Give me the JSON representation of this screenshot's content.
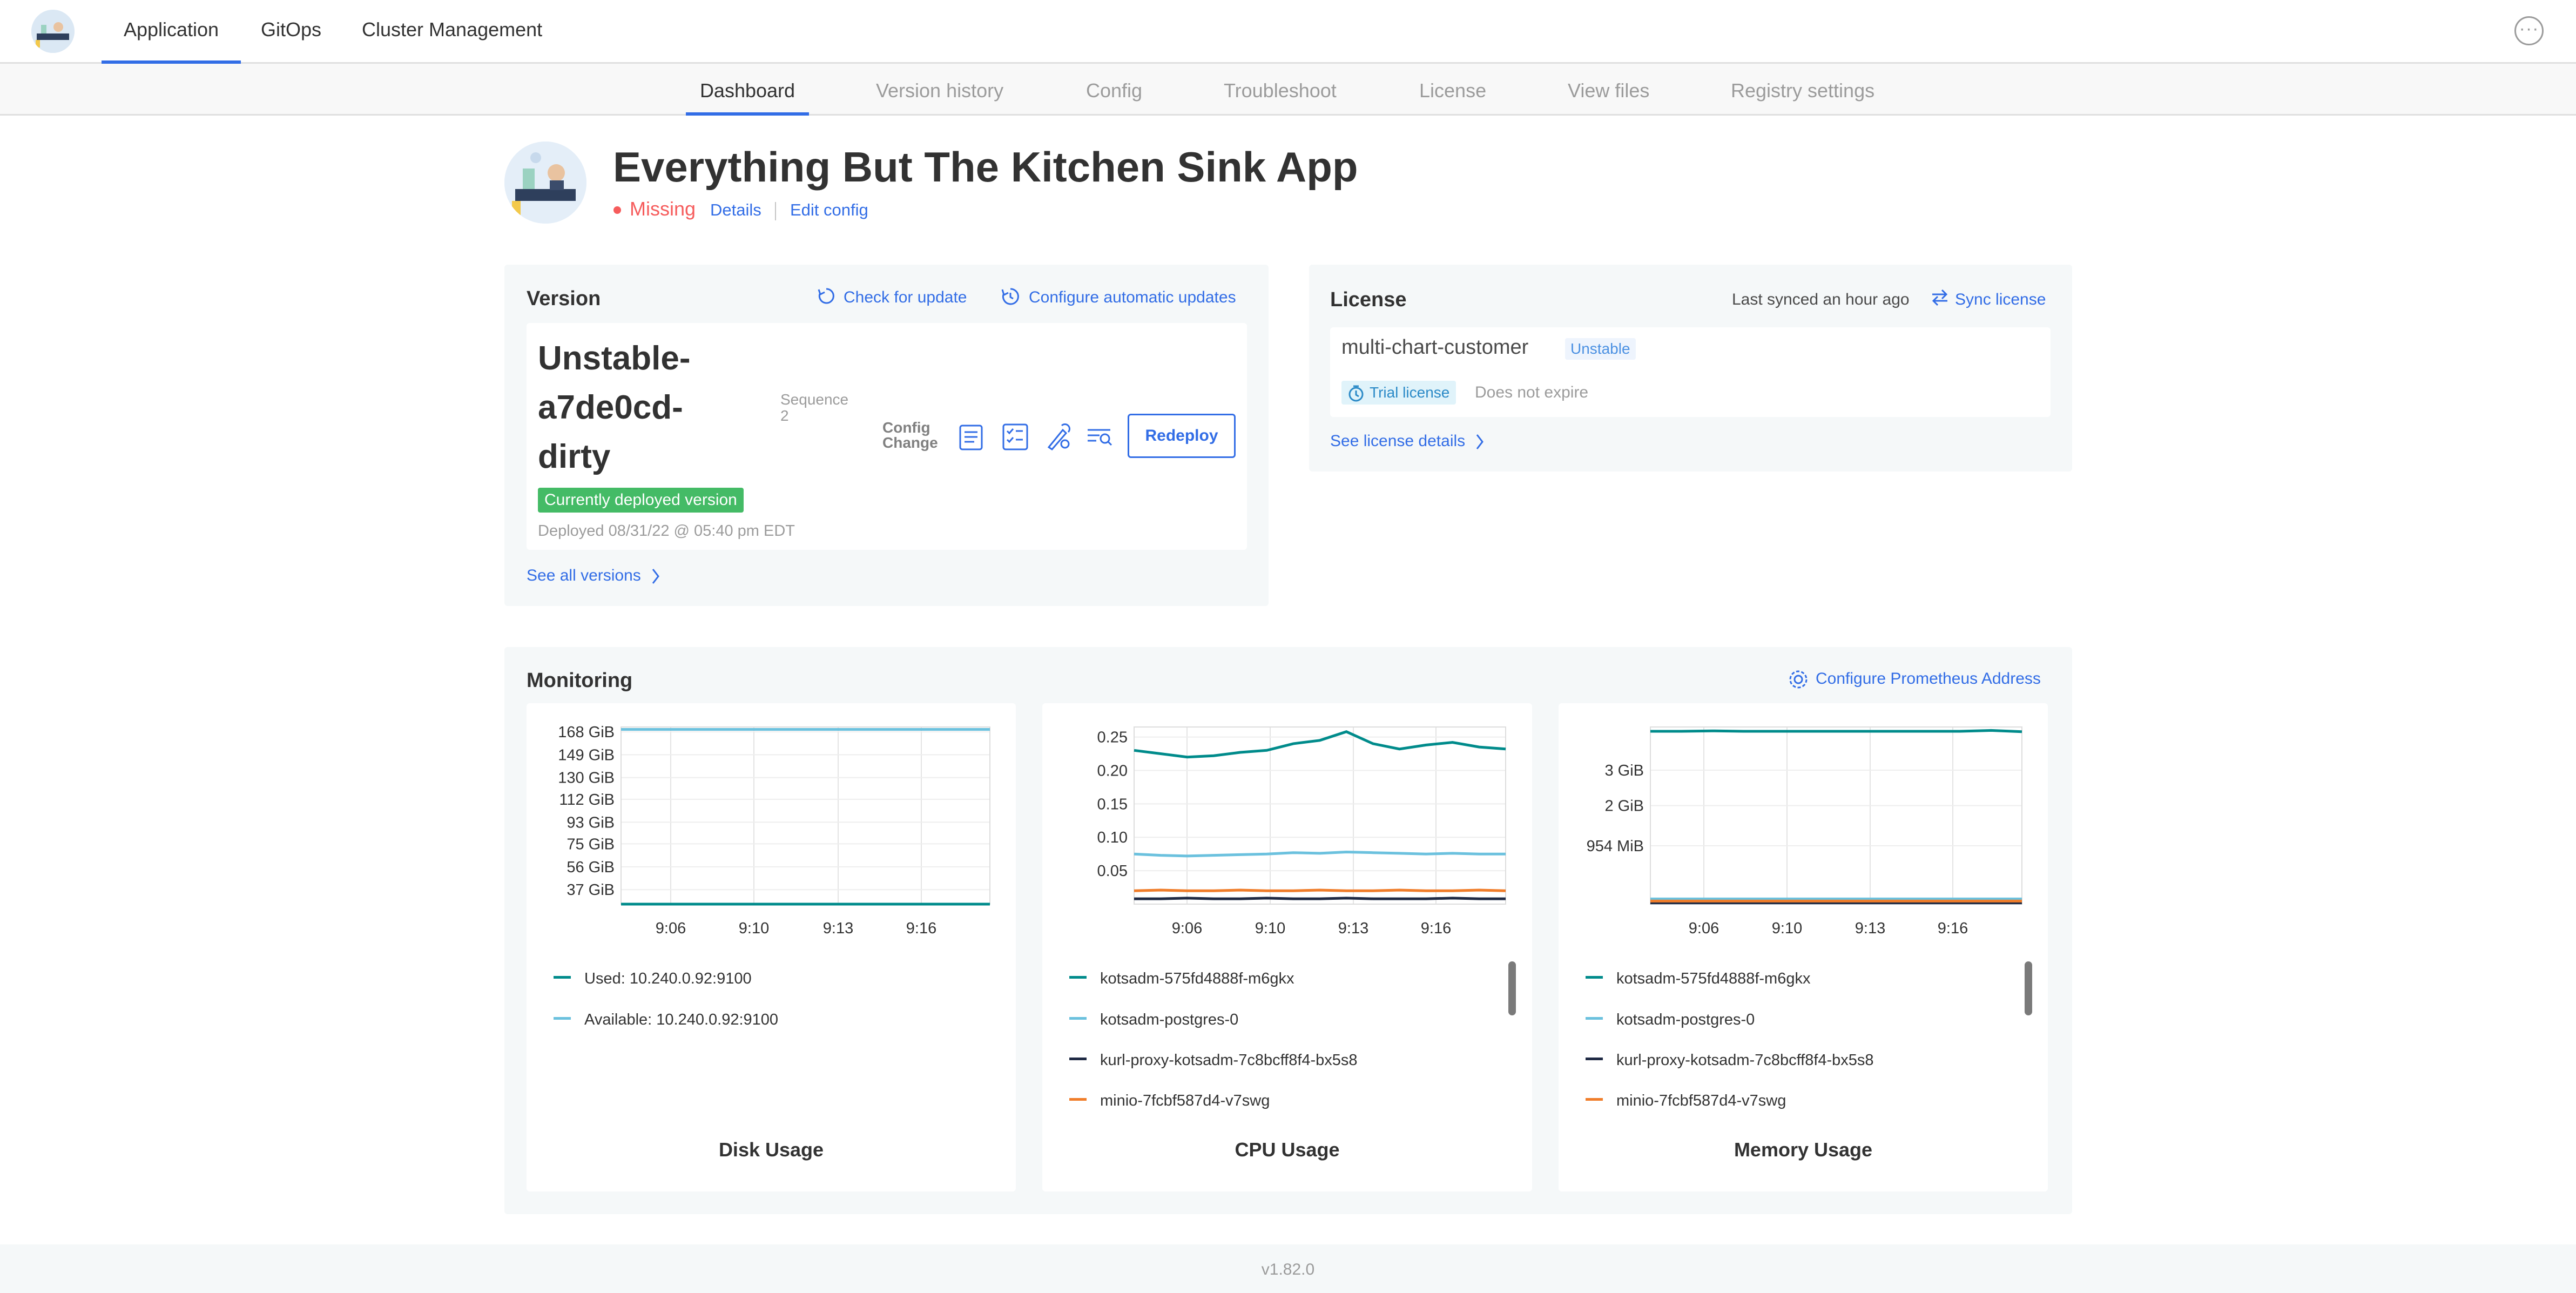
{
  "topnav": {
    "items": [
      {
        "label": "Application"
      },
      {
        "label": "GitOps"
      },
      {
        "label": "Cluster Management"
      }
    ],
    "more_glyph": "···"
  },
  "subnav": {
    "tabs": [
      {
        "label": "Dashboard"
      },
      {
        "label": "Version history"
      },
      {
        "label": "Config"
      },
      {
        "label": "Troubleshoot"
      },
      {
        "label": "License"
      },
      {
        "label": "View files"
      },
      {
        "label": "Registry settings"
      }
    ]
  },
  "app": {
    "title": "Everything But The Kitchen Sink App",
    "status": "Missing",
    "details_link": "Details",
    "edit_config_link": "Edit config"
  },
  "version_card": {
    "title": "Version",
    "check_update": "Check for update",
    "configure_auto": "Configure automatic updates",
    "version_name": "Unstable-a7de0cd-dirty",
    "sequence_label": "Sequence",
    "sequence_value": "2",
    "source_label": "Config Change",
    "deployed_badge": "Currently deployed version",
    "deployed_text": "Deployed 08/31/22 @ 05:40 pm EDT",
    "redeploy": "Redeploy",
    "see_all": "See all versions"
  },
  "license_card": {
    "title": "License",
    "last_synced": "Last synced an hour ago",
    "sync": "Sync license",
    "name": "multi-chart-customer",
    "channel": "Unstable",
    "type": "Trial license",
    "expiry": "Does not expire",
    "see_details": "See license details"
  },
  "monitoring": {
    "title": "Monitoring",
    "configure": "Configure Prometheus Address",
    "colors": {
      "teal": "#008b8b",
      "light_blue": "#6bc1de",
      "navy": "#1f2a44",
      "orange": "#f07d2a",
      "red": "#e0452d"
    }
  },
  "chart_data": [
    {
      "type": "line",
      "title": "Disk Usage",
      "x_ticks": [
        "9:06",
        "9:10",
        "9:13",
        "9:16"
      ],
      "y_ticks": [
        "168 GiB",
        "149 GiB",
        "130 GiB",
        "112 GiB",
        "93 GiB",
        "75 GiB",
        "56 GiB",
        "37 GiB"
      ],
      "ylim": [
        25,
        172
      ],
      "series": [
        {
          "name": "Used: 10.240.0.92:9100",
          "color": "#008b8b",
          "values": [
            25,
            25,
            25,
            25,
            25,
            25,
            25,
            25,
            25,
            25
          ]
        },
        {
          "name": "Available: 10.240.0.92:9100",
          "color": "#6bc1de",
          "values": [
            170,
            170,
            170,
            170,
            170,
            170,
            170,
            170,
            170,
            170
          ]
        }
      ]
    },
    {
      "type": "line",
      "title": "CPU Usage",
      "x_ticks": [
        "9:06",
        "9:10",
        "9:13",
        "9:16"
      ],
      "y_ticks": [
        "0.25",
        "0.20",
        "0.15",
        "0.10",
        "0.05"
      ],
      "ylim": [
        0,
        0.265
      ],
      "series": [
        {
          "name": "kotsadm-575fd4888f-m6gkx",
          "color": "#008b8b",
          "values": [
            0.23,
            0.225,
            0.22,
            0.222,
            0.227,
            0.23,
            0.24,
            0.245,
            0.258,
            0.24,
            0.232,
            0.238,
            0.242,
            0.235,
            0.232
          ]
        },
        {
          "name": "kotsadm-postgres-0",
          "color": "#6bc1de",
          "values": [
            0.075,
            0.073,
            0.072,
            0.073,
            0.074,
            0.075,
            0.077,
            0.076,
            0.078,
            0.077,
            0.076,
            0.075,
            0.076,
            0.075,
            0.075
          ]
        },
        {
          "name": "kurl-proxy-kotsadm-7c8bcff8f4-bx5s8",
          "color": "#1f2a44",
          "values": [
            0.008,
            0.008,
            0.009,
            0.008,
            0.008,
            0.009,
            0.008,
            0.008,
            0.009,
            0.008,
            0.008,
            0.008,
            0.009,
            0.008,
            0.008
          ]
        },
        {
          "name": "minio-7fcbf587d4-v7swg",
          "color": "#f07d2a",
          "values": [
            0.02,
            0.021,
            0.02,
            0.02,
            0.021,
            0.02,
            0.02,
            0.021,
            0.02,
            0.02,
            0.021,
            0.02,
            0.02,
            0.021,
            0.02
          ]
        }
      ]
    },
    {
      "type": "line",
      "title": "Memory Usage",
      "x_ticks": [
        "9:06",
        "9:10",
        "9:13",
        "9:16"
      ],
      "y_ticks": [
        "3 GiB",
        "2 GiB",
        "954 MiB"
      ],
      "ylim": [
        0,
        4.1
      ],
      "series": [
        {
          "name": "kotsadm-575fd4888f-m6gkx",
          "color": "#008b8b",
          "values": [
            4.0,
            4.0,
            4.01,
            4.0,
            4.0,
            4.0,
            4.0,
            4.0,
            4.0,
            4.0,
            4.0,
            4.02,
            3.99
          ]
        },
        {
          "name": "kotsadm-postgres-0",
          "color": "#6bc1de",
          "values": [
            0.12,
            0.12,
            0.12,
            0.12,
            0.12,
            0.12,
            0.12,
            0.12,
            0.12,
            0.12,
            0.12,
            0.12,
            0.12
          ]
        },
        {
          "name": "kurl-proxy-kotsadm-7c8bcff8f4-bx5s8",
          "color": "#1f2a44",
          "values": [
            0.03,
            0.03,
            0.03,
            0.03,
            0.03,
            0.03,
            0.03,
            0.03,
            0.03,
            0.03,
            0.03,
            0.03,
            0.03
          ]
        },
        {
          "name": "minio-7fcbf587d4-v7swg",
          "color": "#f07d2a",
          "values": [
            0.07,
            0.07,
            0.07,
            0.07,
            0.07,
            0.07,
            0.07,
            0.07,
            0.07,
            0.07,
            0.07,
            0.07,
            0.07
          ]
        }
      ]
    }
  ],
  "footer": {
    "version": "v1.82.0"
  }
}
